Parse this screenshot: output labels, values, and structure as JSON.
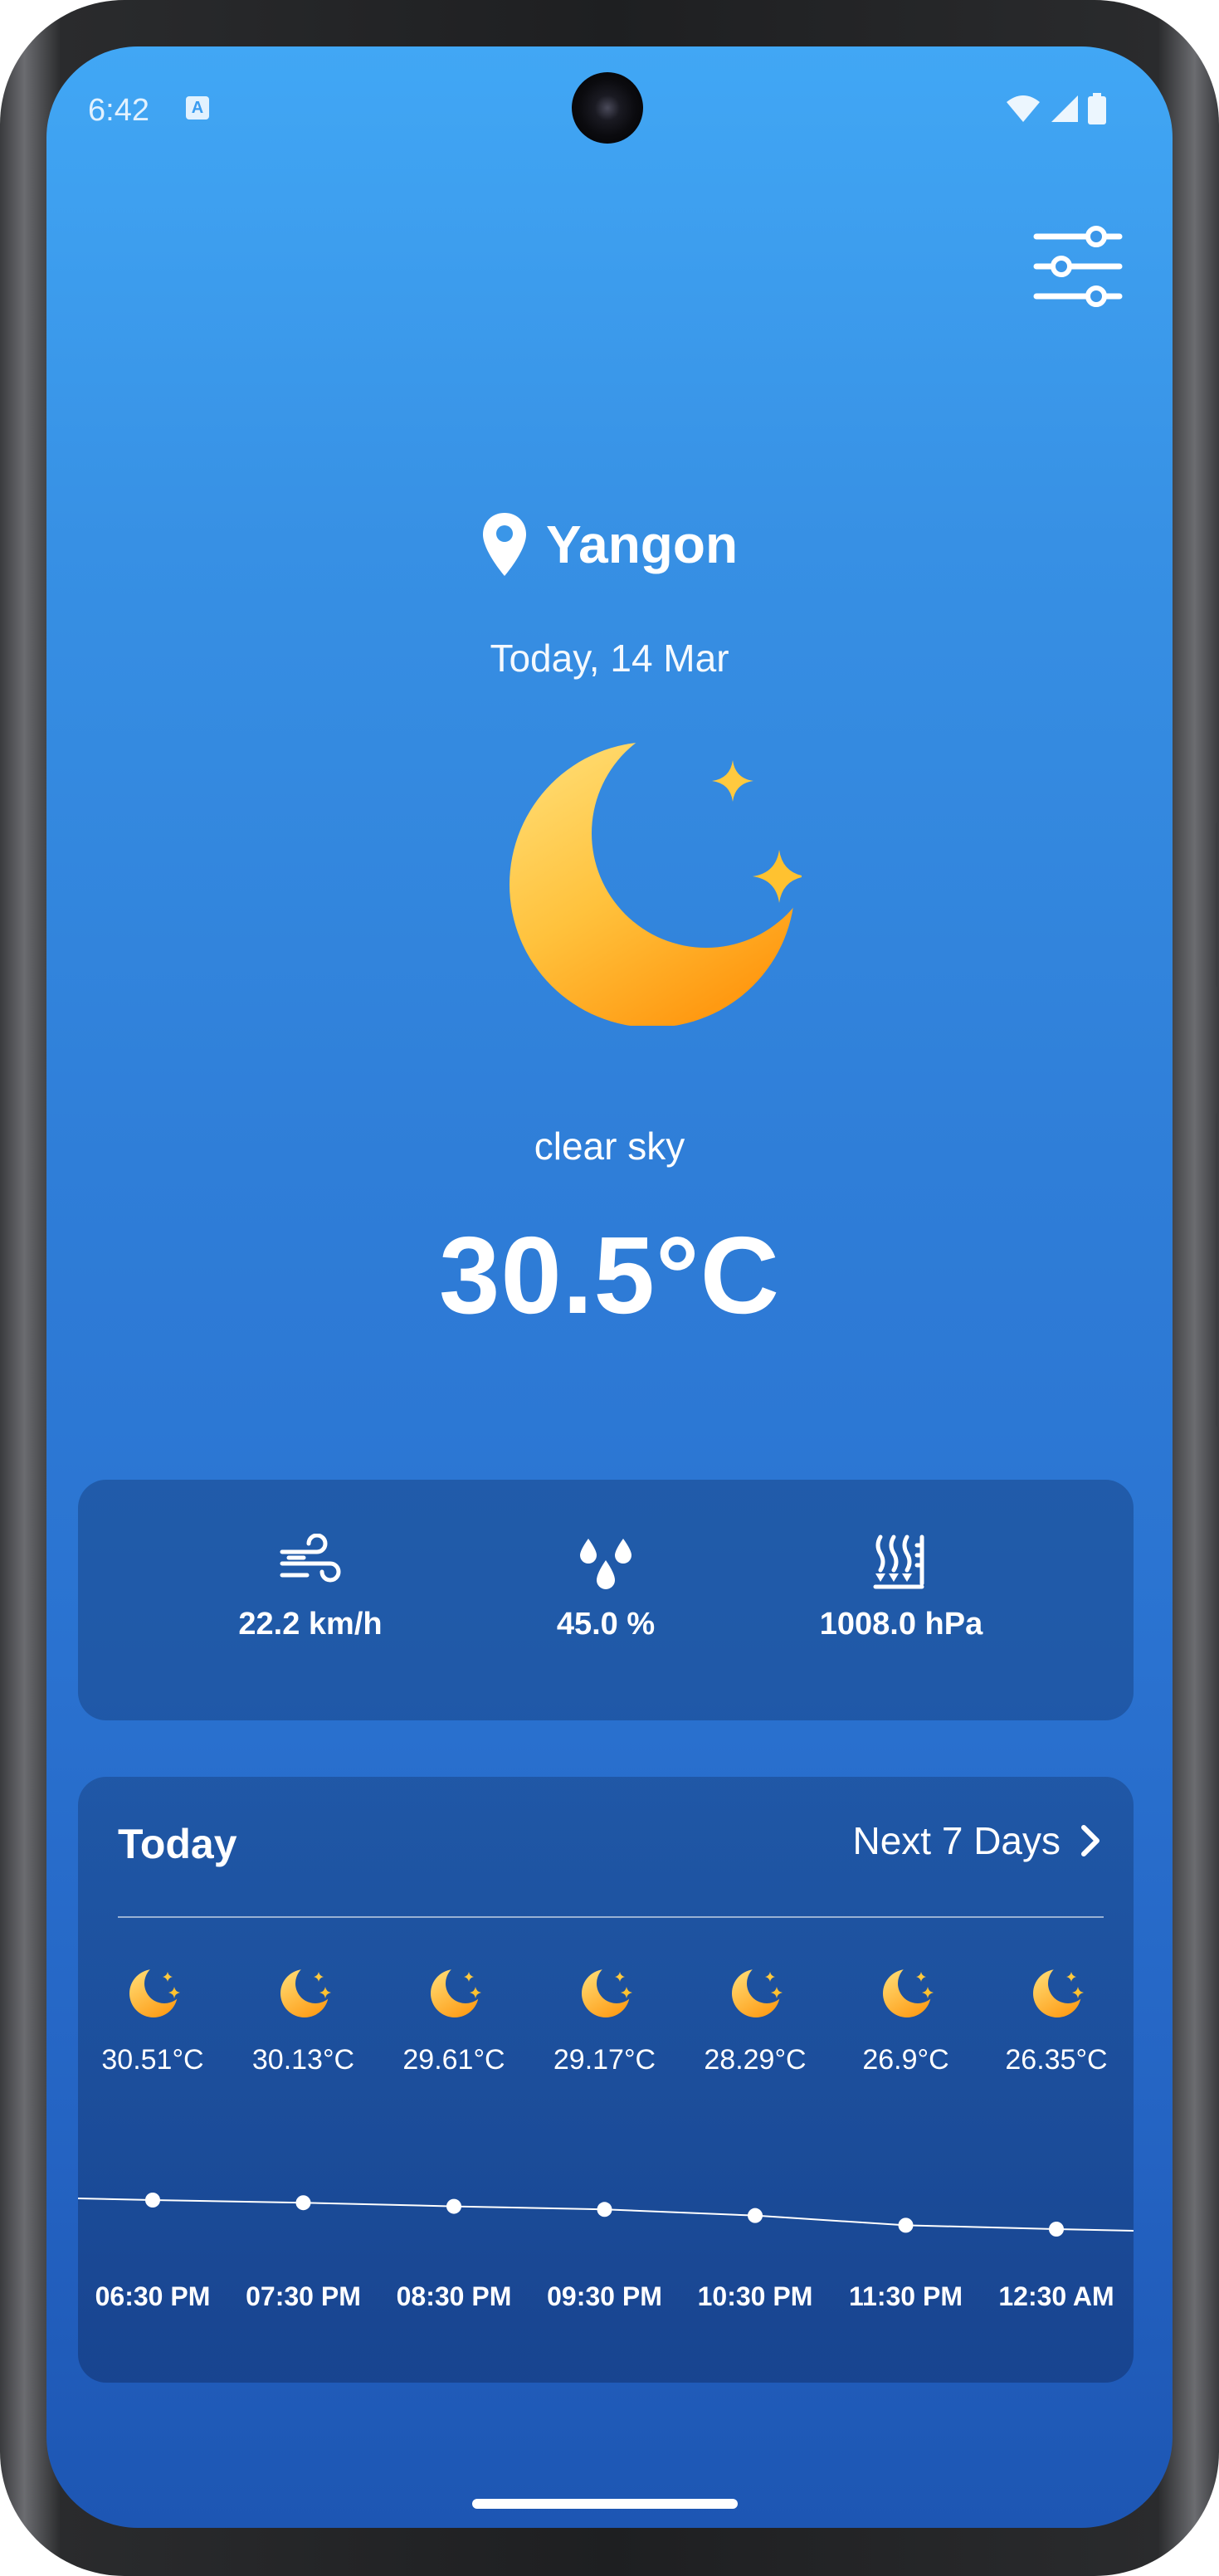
{
  "status_bar": {
    "time": "6:42",
    "notification_glyph": "A",
    "icons": [
      "wifi-icon",
      "signal-icon",
      "battery-icon"
    ]
  },
  "header": {
    "settings_icon": "sliders-icon"
  },
  "location": {
    "icon": "location-pin-icon",
    "name": "Yangon"
  },
  "date": "Today, 14 Mar",
  "current": {
    "icon": "moon-stars-icon",
    "condition": "clear sky",
    "temperature": "30.5°C"
  },
  "stats": [
    {
      "icon": "wind-icon",
      "value": "22.2 km/h"
    },
    {
      "icon": "humidity-icon",
      "value": "45.0 %"
    },
    {
      "icon": "pressure-icon",
      "value": "1008.0 hPa"
    }
  ],
  "forecast": {
    "today_label": "Today",
    "next_label": "Next 7 Days",
    "hours": [
      {
        "icon": "moon-icon",
        "temp": "30.51°C",
        "temp_value": 30.51,
        "time": "06:30 PM"
      },
      {
        "icon": "moon-icon",
        "temp": "30.13°C",
        "temp_value": 30.13,
        "time": "07:30 PM"
      },
      {
        "icon": "moon-icon",
        "temp": "29.61°C",
        "temp_value": 29.61,
        "time": "08:30 PM"
      },
      {
        "icon": "moon-icon",
        "temp": "29.17°C",
        "temp_value": 29.17,
        "time": "09:30 PM"
      },
      {
        "icon": "moon-icon",
        "temp": "28.29°C",
        "temp_value": 28.29,
        "time": "10:30 PM"
      },
      {
        "icon": "moon-icon",
        "temp": "26.9°C",
        "temp_value": 26.9,
        "time": "11:30 PM"
      },
      {
        "icon": "moon-icon",
        "temp": "26.35°C",
        "temp_value": 26.35,
        "time": "12:30 AM"
      }
    ]
  },
  "colors": {
    "accent_moon_light": "#ffd96b",
    "accent_moon_dark": "#ff9f1a",
    "background_top": "#41a7f5",
    "background_bottom": "#1d56b3"
  }
}
